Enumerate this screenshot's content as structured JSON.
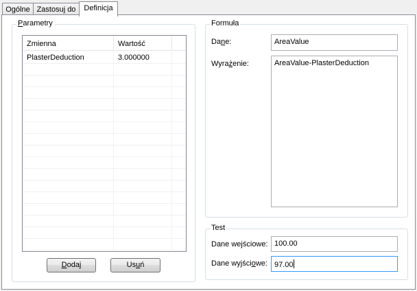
{
  "tabs": [
    {
      "label": "Ogólne"
    },
    {
      "label": "Zastosuj do"
    },
    {
      "label": "Definicja",
      "active": true
    }
  ],
  "parametry": {
    "title_pre": "P",
    "title_rest": "arametry",
    "columns": [
      "Zmienna",
      "Wartość"
    ],
    "rows": [
      {
        "name": "PlasterDeduction",
        "value": "3.000000"
      }
    ],
    "add_button_u": "D",
    "add_button_rest": "odaj",
    "remove_button_pre": "Us",
    "remove_button_u": "u",
    "remove_button_rest": "ń"
  },
  "formula": {
    "title": "Formuła",
    "dane_label_pre": "Da",
    "dane_label_u": "n",
    "dane_label_rest": "e:",
    "dane_value": "AreaValue",
    "wyrazenie_label_pre": "Wyra",
    "wyrazenie_label_u": "ż",
    "wyrazenie_label_rest": "enie:",
    "wyrazenie_value": "AreaValue-PlasterDeduction"
  },
  "test": {
    "title": "Test",
    "input_label_pre": "Dane we",
    "input_label_u": "j",
    "input_label_rest": "ściowe:",
    "input_value": "100.00",
    "output_label_pre": "Dane wyjści",
    "output_label_u": "o",
    "output_label_rest": "we:",
    "output_value": "97.00"
  }
}
